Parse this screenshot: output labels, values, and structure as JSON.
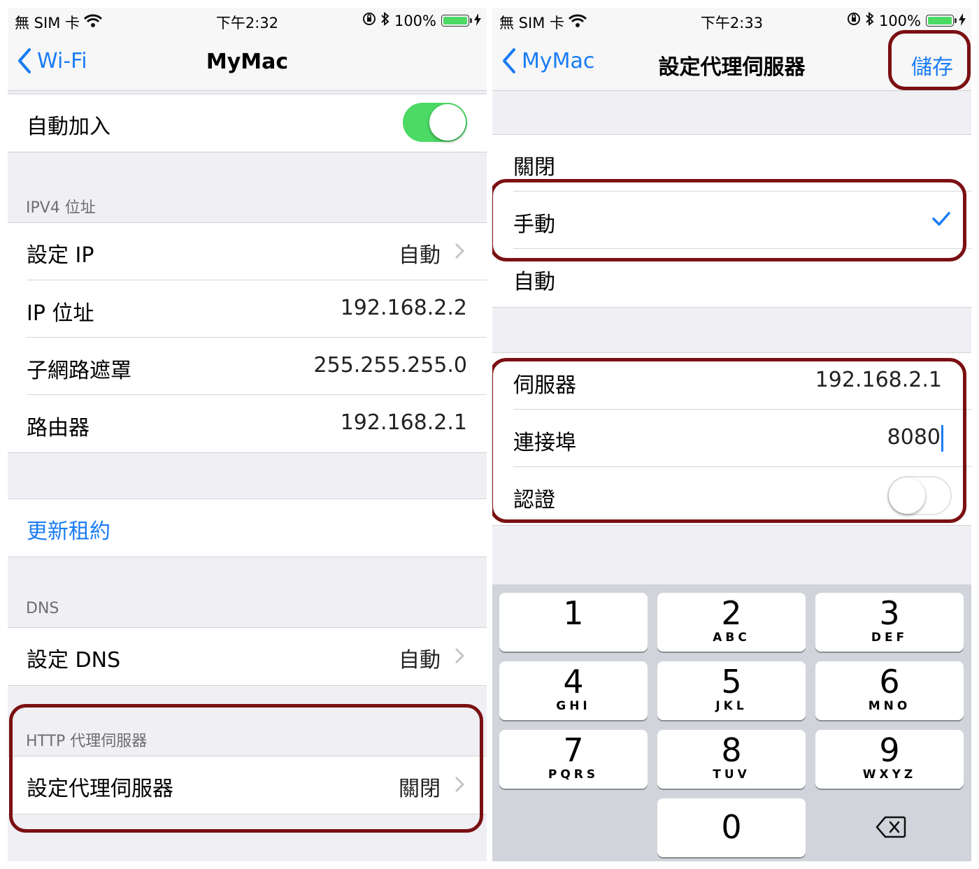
{
  "status_left": {
    "carrier": "無 SIM 卡",
    "time": "下午2:32",
    "battery": "100%"
  },
  "status_right": {
    "carrier": "無 SIM 卡",
    "time": "下午2:33",
    "battery": "100%"
  },
  "left": {
    "nav": {
      "back": "Wi-Fi",
      "title": "MyMac"
    },
    "auto_join": {
      "label": "自動加入",
      "on": true
    },
    "ipv4_header": "IPV4 位址",
    "ipv4_rows": [
      {
        "label": "設定 IP",
        "value": "自動"
      },
      {
        "label": "IP 位址",
        "value": "192.168.2.2"
      },
      {
        "label": "子網路遮罩",
        "value": "255.255.255.0"
      },
      {
        "label": "路由器",
        "value": "192.168.2.1"
      }
    ],
    "renew": "更新租約",
    "dns_header": "DNS",
    "dns_row": {
      "label": "設定 DNS",
      "value": "自動"
    },
    "proxy_header": "HTTP 代理伺服器",
    "proxy_row": {
      "label": "設定代理伺服器",
      "value": "關閉"
    }
  },
  "right": {
    "nav": {
      "back": "MyMac",
      "title": "設定代理伺服器",
      "action": "儲存"
    },
    "options": [
      "關閉",
      "手動",
      "自動"
    ],
    "selected": "手動",
    "fields": {
      "server_label": "伺服器",
      "server_value": "192.168.2.1",
      "port_label": "連接埠",
      "port_value": "8080",
      "auth_label": "認證",
      "auth_on": false
    },
    "keypad": [
      {
        "num": "1",
        "letters": ""
      },
      {
        "num": "2",
        "letters": "ABC"
      },
      {
        "num": "3",
        "letters": "DEF"
      },
      {
        "num": "4",
        "letters": "GHI"
      },
      {
        "num": "5",
        "letters": "JKL"
      },
      {
        "num": "6",
        "letters": "MNO"
      },
      {
        "num": "7",
        "letters": "PQRS"
      },
      {
        "num": "8",
        "letters": "TUV"
      },
      {
        "num": "9",
        "letters": "WXYZ"
      },
      {
        "num": "0",
        "letters": ""
      }
    ]
  },
  "colors": {
    "accent": "#1a7cf5",
    "switch_on": "#4cd964",
    "highlight": "#7b1012",
    "group_bg": "#efeff4"
  }
}
